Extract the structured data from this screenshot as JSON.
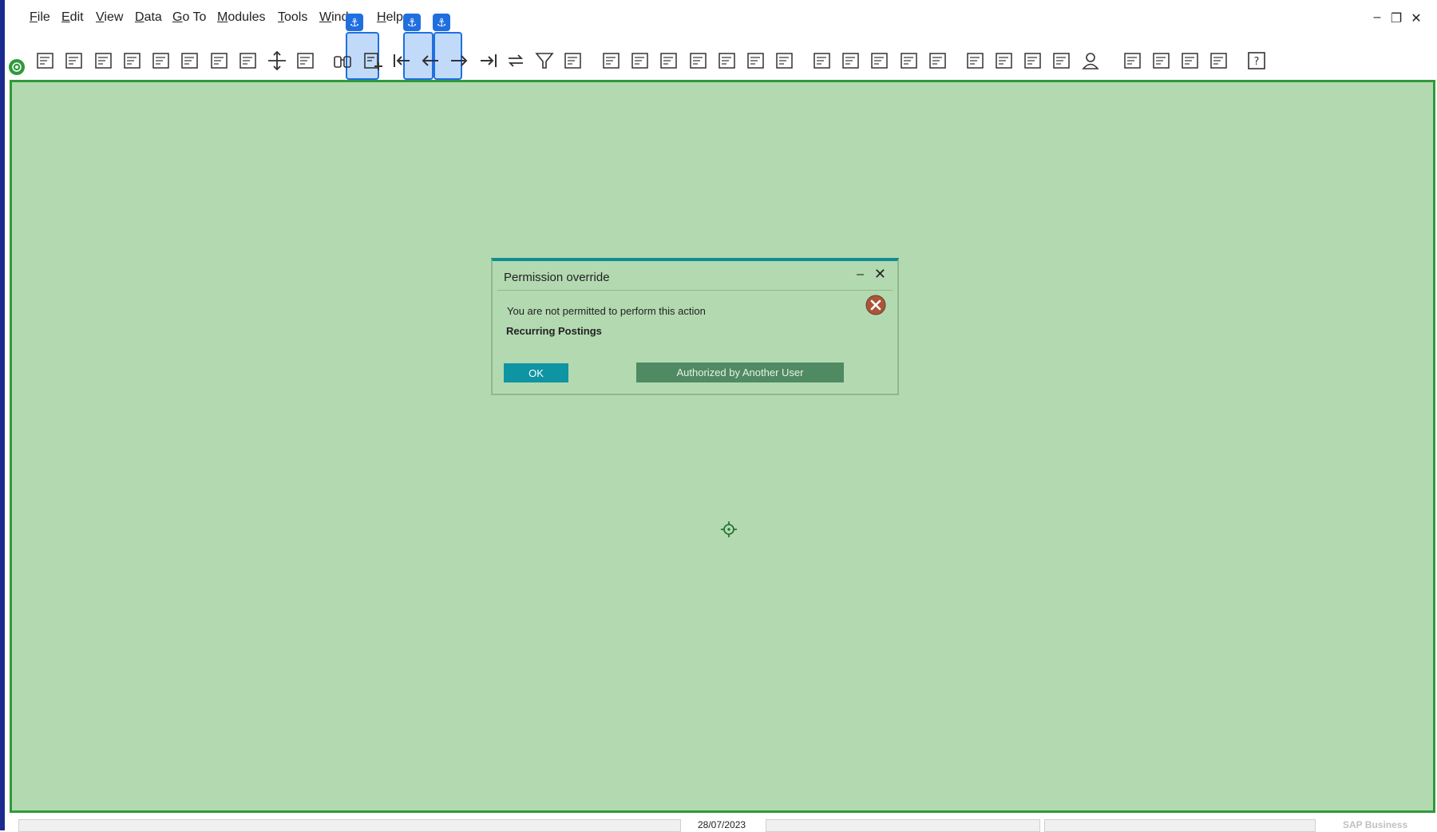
{
  "menu": {
    "items": [
      {
        "label": "File",
        "ul": "F",
        "rest": "ile"
      },
      {
        "label": "Edit",
        "ul": "E",
        "rest": "dit"
      },
      {
        "label": "View",
        "ul": "V",
        "rest": "iew"
      },
      {
        "label": "Data",
        "ul": "D",
        "rest": "ata"
      },
      {
        "label": "Go To",
        "ul": "G",
        "rest": "o To"
      },
      {
        "label": "Modules",
        "ul": "M",
        "rest": "odules"
      },
      {
        "label": "Tools",
        "ul": "T",
        "rest": "ools"
      },
      {
        "label": "Wind",
        "ul": "W",
        "rest": "ind"
      },
      {
        "label": "Help",
        "ul": "H",
        "rest": "elp"
      }
    ],
    "window_controls": {
      "minimize": "–",
      "restore": "❐",
      "close": "✕"
    }
  },
  "toolbar": {
    "anchor_glyph": "⚓",
    "icons": [
      "preview-icon",
      "print-icon",
      "email-icon",
      "sms-icon",
      "fax-icon",
      "excel-icon",
      "word-icon",
      "pdf-icon",
      "move-icon",
      "layout-icon",
      "find-icon",
      "add-icon",
      "first-record-icon",
      "previous-record-icon",
      "next-record-icon",
      "last-record-icon",
      "refresh-icon",
      "filter-icon",
      "sort-icon",
      "base-document-icon",
      "target-document-icon",
      "gross-profit-icon",
      "payment-icon",
      "balance-icon",
      "journal-icon",
      "trans-journal-icon",
      "edit-icon",
      "settings-icon",
      "form-settings-icon",
      "message-icon",
      "alerts-icon",
      "activity-icon",
      "campaign-icon",
      "calendar-icon",
      "org-icon",
      "user-icon",
      "dashboard-icon",
      "widget-icon",
      "chart-icon",
      "report-icon",
      "help-icon"
    ]
  },
  "dialog": {
    "title": "Permission override",
    "min_glyph": "–",
    "close_glyph": "✕",
    "message": "You are not permitted to perform this action",
    "subject": "Recurring Postings",
    "ok_label": "OK",
    "authorized_label": "Authorized by Another User"
  },
  "statusbar": {
    "date": "28/07/2023",
    "brand": "SAP Business"
  },
  "colors": {
    "workspace": "#b3d9b1",
    "dialog_accent": "#108b94",
    "ok_button": "#0e94a2",
    "auth_button": "#4f8a62",
    "highlight": "#1f6fe0"
  }
}
